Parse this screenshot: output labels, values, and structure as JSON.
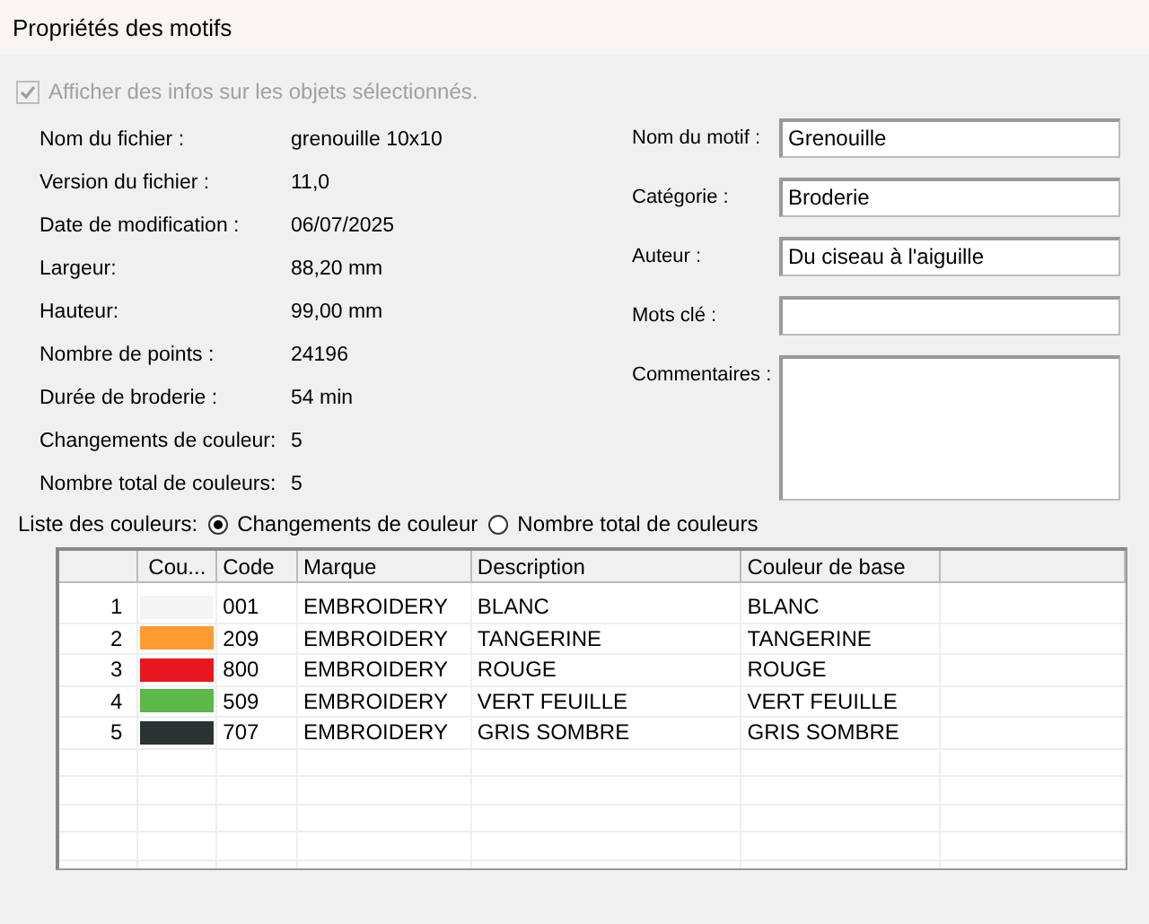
{
  "window": {
    "title": "Propriétés des motifs"
  },
  "show_info": {
    "label": "Afficher des infos sur les objets sélectionnés.",
    "checked": true,
    "disabled": true
  },
  "info": [
    {
      "label": "Nom du fichier :",
      "value": "grenouille 10x10"
    },
    {
      "label": "Version du fichier :",
      "value": "11,0"
    },
    {
      "label": "Date de modification :",
      "value": "06/07/2025"
    },
    {
      "label": "Largeur:",
      "value": "88,20 mm"
    },
    {
      "label": "Hauteur:",
      "value": "99,00 mm"
    },
    {
      "label": "Nombre de points :",
      "value": "24196"
    },
    {
      "label": "Durée de broderie :",
      "value": "54 min"
    },
    {
      "label": "Changements de couleur:",
      "value": "5"
    },
    {
      "label": "Nombre total de couleurs:",
      "value": "5"
    }
  ],
  "fields": [
    {
      "label": "Nom du motif :",
      "value": "Grenouille",
      "kind": "line"
    },
    {
      "label": "Catégorie :",
      "value": "Broderie",
      "kind": "line"
    },
    {
      "label": "Auteur :",
      "value": "Du ciseau à l'aiguille",
      "kind": "line"
    },
    {
      "label": "Mots clé :",
      "kind": "line"
    },
    {
      "label": "Commentaires :",
      "kind": "area"
    }
  ],
  "color_list": {
    "label": "Liste des couleurs:",
    "options": [
      {
        "label": "Changements de couleur",
        "selected": true
      },
      {
        "label": "Nombre total de couleurs",
        "selected": false
      }
    ]
  },
  "table": {
    "columns": [
      "Cou...",
      "Code",
      "Marque",
      "Description",
      "Couleur de base"
    ],
    "rows": [
      {
        "index": "1",
        "color": "#f4f4f4",
        "code": "001",
        "brand": "EMBROIDERY",
        "description": "BLANC",
        "base": "BLANC"
      },
      {
        "index": "2",
        "color": "#ff9b30",
        "code": "209",
        "brand": "EMBROIDERY",
        "description": "TANGERINE",
        "base": "TANGERINE"
      },
      {
        "index": "3",
        "color": "#e8161e",
        "code": "800",
        "brand": "EMBROIDERY",
        "description": "ROUGE",
        "base": "ROUGE"
      },
      {
        "index": "4",
        "color": "#5cb848",
        "code": "509",
        "brand": "EMBROIDERY",
        "description": "VERT FEUILLE",
        "base": "VERT FEUILLE"
      },
      {
        "index": "5",
        "color": "#2a3232",
        "code": "707",
        "brand": "EMBROIDERY",
        "description": "GRIS SOMBRE",
        "base": "GRIS SOMBRE"
      }
    ]
  }
}
